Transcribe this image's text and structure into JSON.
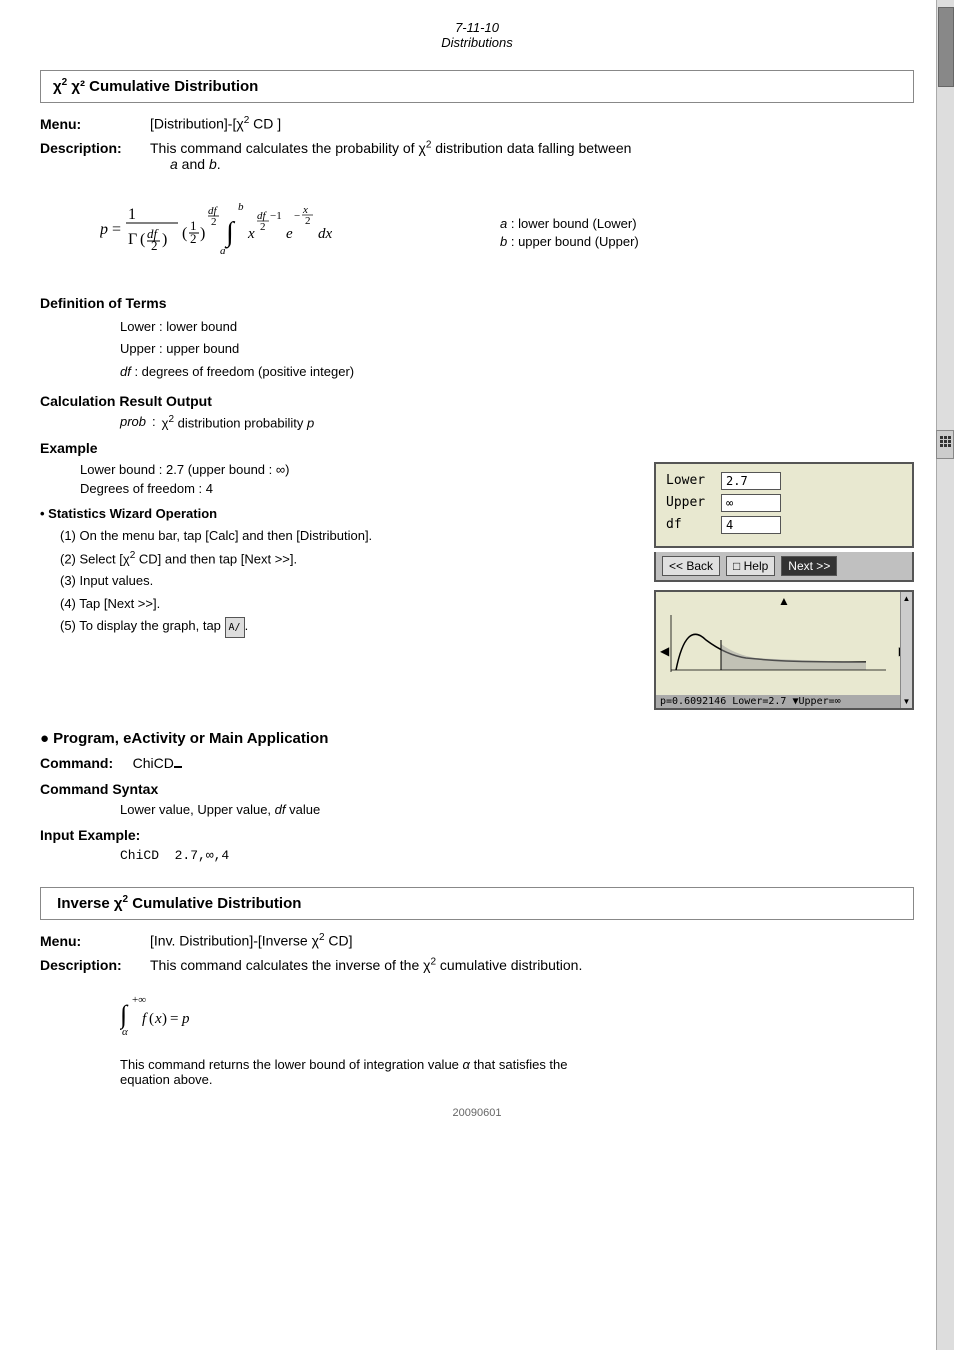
{
  "header": {
    "line1": "7-11-10",
    "line2": "Distributions"
  },
  "chi_cumulative": {
    "box_title": "χ² Cumulative Distribution",
    "menu_label": "Menu:",
    "menu_value": "[Distribution]-[χ² CD ]",
    "desc_label": "Description:",
    "desc_text": "This command calculates the probability of χ² distribution data falling between",
    "desc_text2": "a and b.",
    "formula_note_a": "a : lower bound (Lower)",
    "formula_note_b": "b : upper bound (Upper)",
    "def_title": "Definition of Terms",
    "def_lower": "Lower :   lower bound",
    "def_upper": "Upper :   upper bound",
    "def_df": "df :        degrees of freedom (positive integer)",
    "calc_title": "Calculation Result Output",
    "calc_prob": "prob :   χ² distribution probability p",
    "example_title": "Example",
    "example_text1": "Lower bound : 2.7 (upper bound : ∞)",
    "example_text2": "Degrees of freedom : 4",
    "wizard_title": "• Statistics Wizard Operation",
    "steps": [
      "(1) On the menu bar, tap [Calc] and then [Distribution].",
      "(2) Select [χ² CD] and then tap [Next >>].",
      "(3) Input values.",
      "(4) Tap [Next >>].",
      "(5) To display the graph, tap [A/]."
    ],
    "calc_screen": {
      "lower_label": "Lower",
      "lower_value": "2.7",
      "upper_label": "Upper",
      "upper_value": "∞",
      "df_label": "df",
      "df_value": "4"
    },
    "calc_buttons": {
      "back": "<< Back",
      "help": "□ Help",
      "next": "Next >>"
    },
    "graph_status": "p=0.6092146",
    "graph_status2": "Lower=2.7",
    "graph_status3": "▼Upper=∞"
  },
  "program_section": {
    "title": "Program, eActivity or Main Application",
    "command_label": "Command:",
    "command_value": "ChiCD",
    "syntax_title": "Command Syntax",
    "syntax_value": "Lower value, Upper value, df value",
    "input_title": "Input Example:",
    "input_value": "ChiCD  2.7,∞,4"
  },
  "inverse_chi": {
    "box_title": "Inverse χ² Cumulative Distribution",
    "menu_label": "Menu:",
    "menu_value": "[Inv. Distribution]-[Inverse χ² CD]",
    "desc_label": "Description:",
    "desc_text": "This command calculates the inverse of the χ² cumulative distribution.",
    "formula_text": "∫+∞ f(x) = p",
    "formula_sub": "α",
    "desc2": "This command returns the lower bound of integration value α that satisfies the",
    "desc3": "equation above."
  },
  "footer": {
    "date": "20090601"
  }
}
